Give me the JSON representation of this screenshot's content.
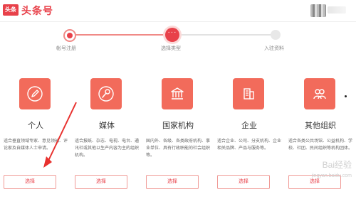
{
  "header": {
    "logo_badge": "头条",
    "brand": "头条号"
  },
  "stepper": {
    "steps": [
      {
        "label": "帐号注册",
        "state": "done"
      },
      {
        "label": "选择类型",
        "state": "current",
        "marker": "···"
      },
      {
        "label": "入驻资料",
        "state": "pending"
      }
    ]
  },
  "cards": [
    {
      "title": "个人",
      "icon": "pen-icon",
      "desc": "适合垂直领域专家、意见领袖、评论家及自媒体人士申请。",
      "button": "选择"
    },
    {
      "title": "媒体",
      "icon": "microphone-icon",
      "desc": "适合报纸、杂志、电视、电台、通讯社或其他以生产内容为主的组织机构。",
      "button": "选择"
    },
    {
      "title": "国家机构",
      "icon": "government-building-icon",
      "desc": "国内外、各级、各类政府机构、事业单位、具有行政职能的社会组织等。",
      "button": "选择"
    },
    {
      "title": "企业",
      "icon": "office-building-icon",
      "desc": "适合企业、公司、分支机构、企业相关品牌、产品与服务等。",
      "button": "选择"
    },
    {
      "title": "其他组织",
      "icon": "people-group-icon",
      "desc": "适合各类公共场馆、公益机构、学校、社团、民间组织等机构团体。",
      "button": "选择"
    }
  ],
  "watermark": {
    "line1": "Bai经验",
    "line2": "jingyan.baidu.com"
  },
  "colors": {
    "brand_red": "#e8414a",
    "icon_bg": "#f26b5b",
    "step_done_line": "#f08a87",
    "step_pending_line": "#e2e2e2"
  }
}
